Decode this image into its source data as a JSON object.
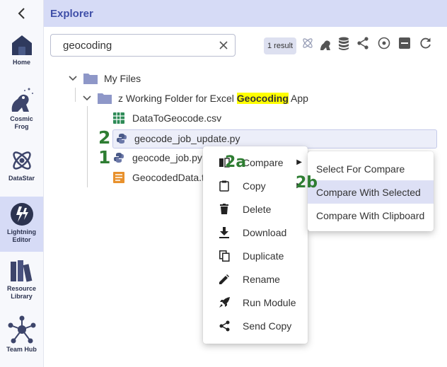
{
  "sidebar": {
    "items": [
      {
        "label": "Home"
      },
      {
        "label": "Cosmic\nFrog"
      },
      {
        "label": "DataStar"
      },
      {
        "label": "Lightning\nEditor"
      },
      {
        "label": "Resource\nLibrary"
      },
      {
        "label": "Team Hub"
      }
    ]
  },
  "header": {
    "title": "Explorer"
  },
  "search": {
    "value": "geocoding",
    "result_count": "1 result"
  },
  "tree": {
    "root": "My Files",
    "folder_prefix": "z Working Folder for Excel ",
    "folder_highlight": "Geocoding",
    "folder_suffix": " App",
    "files": [
      "DataToGeocode.csv",
      "geocode_job_update.py",
      "geocode_job.py",
      "GeocodedData.t"
    ]
  },
  "annotations": {
    "step1": "1",
    "step2": "2",
    "step2a": "2a",
    "step2b": "2b"
  },
  "context_menu": {
    "items": [
      "Compare",
      "Copy",
      "Delete",
      "Download",
      "Duplicate",
      "Rename",
      "Run Module",
      "Send Copy"
    ]
  },
  "compare_submenu": {
    "items": [
      "Select For Compare",
      "Compare With Selected",
      "Compare With Clipboard"
    ]
  },
  "colors": {
    "accent": "#3f4fa8",
    "header_bg": "#d6dbf6",
    "annotation": "#2e7d32",
    "highlight": "#ffff00"
  }
}
